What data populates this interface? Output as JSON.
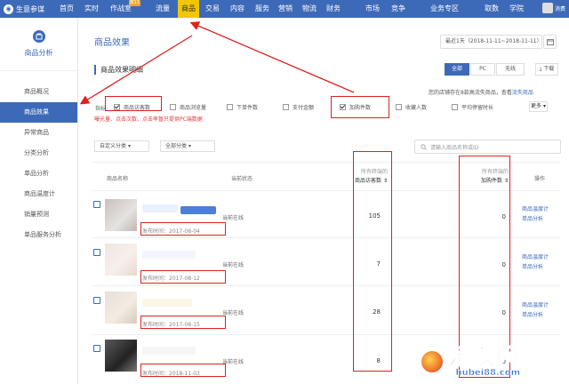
{
  "topnav": {
    "brand": "生意参谋",
    "items": [
      "首页",
      "实时",
      "作战室",
      "流量",
      "商品",
      "交易",
      "内容",
      "服务",
      "营销",
      "物流",
      "财务",
      "市场",
      "竞争",
      "业务专区",
      "取数",
      "学院"
    ],
    "active": "商品",
    "badge": "双11",
    "user": "消费"
  },
  "sidebar": {
    "title": "商品分析",
    "items": [
      "商品概况",
      "商品效果",
      "异常商品",
      "分类分析",
      "单品分析",
      "商品温度计",
      "销量预测",
      "单品服务分析"
    ],
    "active": "商品效果"
  },
  "main": {
    "page_title": "商品效果",
    "date_range": "最近1天（2018-11-11~2018-11-11）",
    "section_title": "商品效果明细",
    "segments": [
      "全部",
      "PC",
      "无线"
    ],
    "active_segment": "全部",
    "download": "下载",
    "hint": "您的店铺存在8款高流失商品，查看",
    "hint_link": "流失商品",
    "indicator_label": "指标:",
    "indicators": [
      {
        "label": "商品访客数",
        "checked": true
      },
      {
        "label": "商品浏览量",
        "checked": false
      },
      {
        "label": "下单件数",
        "checked": false
      },
      {
        "label": "支付金额",
        "checked": false
      },
      {
        "label": "加购件数",
        "checked": true
      },
      {
        "label": "收藏人数",
        "checked": false
      },
      {
        "label": "平均停留时长",
        "checked": false
      }
    ],
    "more": "更多",
    "warning": "曝光量、点击次数、点击率暂只提供PC端数据",
    "filter_custom": "自定义分类",
    "filter_all": "全部分类",
    "search_placeholder": "请输入商品名称或ID",
    "columns": {
      "name": "商品名称",
      "status": "当前状态",
      "visitors_top": "所有终端的",
      "visitors": "商品访客数",
      "cart_top": "所有终端的",
      "cart": "加购件数",
      "action": "操作"
    },
    "rows": [
      {
        "publish": "发布时间：2017-08-04",
        "status": "当前在线",
        "visitors": "105",
        "cart": "0"
      },
      {
        "publish": "发布时间：2017-08-12",
        "status": "当前在线",
        "visitors": "7",
        "cart": "0"
      },
      {
        "publish": "发布时间：2017-08-15",
        "status": "当前在线",
        "visitors": "28",
        "cart": "0"
      },
      {
        "publish": "发布时间：2018-11-03",
        "status": "当前在线",
        "visitors": "8",
        "cart": "0"
      }
    ],
    "actions": [
      "商品温度计",
      "单品分析"
    ]
  },
  "watermark": {
    "big": "楚汉网",
    "small": "hubei88.com"
  },
  "colors": {
    "nav": "#3d6ab8",
    "active_tab": "#f2c600",
    "annotation": "#e02020",
    "link": "#3d6ab8"
  }
}
